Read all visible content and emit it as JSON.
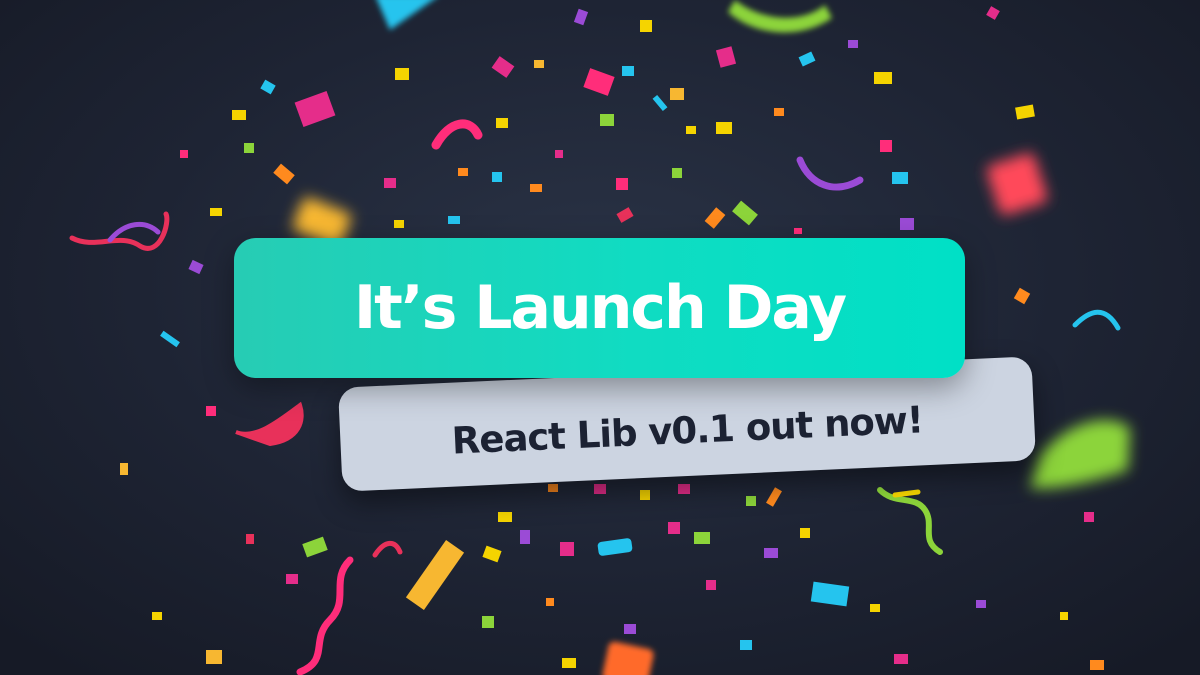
{
  "headline": {
    "text": "It’s Launch Day"
  },
  "subheadline": {
    "text": "React Lib v0.1 out now!"
  },
  "colors": {
    "background": "#1e2434",
    "headline_banner": "#10dcc2",
    "headline_text": "#ffffff",
    "sub_banner": "#ccd4e1",
    "sub_text": "#1c2233",
    "confetti": [
      "#ff2d7a",
      "#f5d400",
      "#25c4ee",
      "#8cd43a",
      "#ff8a1e",
      "#9b4bd6",
      "#e8315a",
      "#f7b731",
      "#3ad2c4"
    ]
  },
  "decoration": {
    "background_pattern": "confetti"
  }
}
